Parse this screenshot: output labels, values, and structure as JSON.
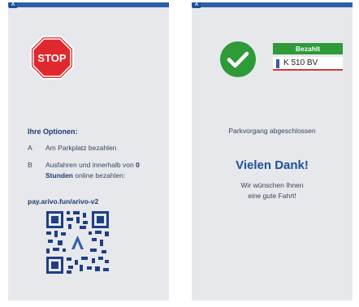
{
  "left": {
    "logo": "A",
    "stop_label": "STOP",
    "options_title": "Ihre Optionen:",
    "option_a": {
      "letter": "A",
      "text": "Am Parkplatz bezahlen"
    },
    "option_b": {
      "letter": "B",
      "text_1": "Ausfahren und innerhalb von ",
      "hours": "0",
      "text_2": "Stunden",
      "text_3": " online bezahlen:"
    },
    "payment_url": "pay.arivo.fun/arivo-v2"
  },
  "right": {
    "logo": "A",
    "paid_badge": "Bezahlt",
    "license_plate": "K 510 BV",
    "status": "Parkvorgang abgeschlossen",
    "thanks": "Vielen Dank!",
    "wish_line_1": "Wir wünschen Ihnen",
    "wish_line_2": "eine gute Fahrt!"
  },
  "colors": {
    "accent": "#1d4f99",
    "stop_red": "#e0282e",
    "success_green": "#2e9a38",
    "background": "#e7e8ec"
  }
}
